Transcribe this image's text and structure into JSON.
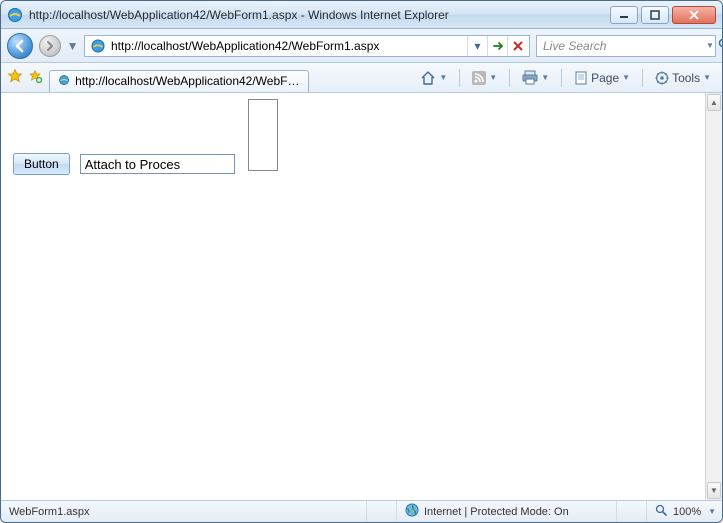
{
  "window": {
    "title": "http://localhost/WebApplication42/WebForm1.aspx - Windows Internet Explorer"
  },
  "address": {
    "url": "http://localhost/WebApplication42/WebForm1.aspx"
  },
  "search": {
    "placeholder": "Live Search"
  },
  "tab": {
    "label": "http://localhost/WebApplication42/WebForm1.a..."
  },
  "toolbar": {
    "page_label": "Page",
    "tools_label": "Tools"
  },
  "form": {
    "button_label": "Button",
    "textbox_value": "Attach to Proces"
  },
  "status": {
    "left": "WebForm1.aspx",
    "zone": "Internet | Protected Mode: On",
    "zoom": "100%"
  }
}
